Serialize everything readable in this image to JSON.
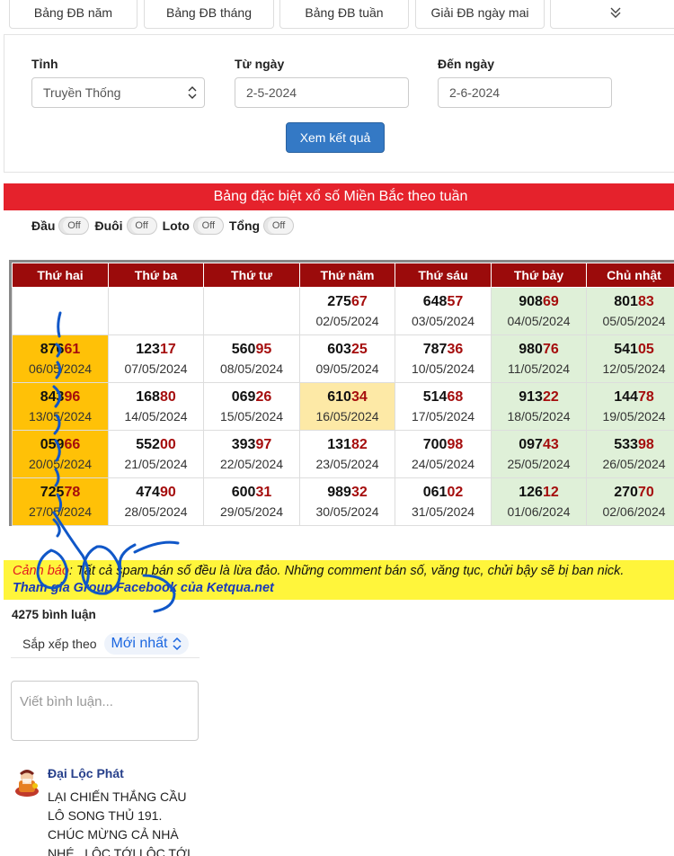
{
  "tabs": [
    {
      "label": "Bảng ĐB năm"
    },
    {
      "label": "Bảng ĐB tháng"
    },
    {
      "label": "Bảng ĐB tuần"
    },
    {
      "label": "Giải ĐB ngày mai"
    }
  ],
  "filter": {
    "province_label": "Tỉnh",
    "province_value": "Truyền Thống",
    "from_label": "Từ ngày",
    "from_value": "2-5-2024",
    "to_label": "Đến ngày",
    "to_value": "2-6-2024",
    "submit_label": "Xem kết quả"
  },
  "table_title": "Bảng đặc biệt xổ số Miền Bắc theo tuần",
  "toggles": [
    {
      "label": "Đầu",
      "state": "Off"
    },
    {
      "label": "Đuôi",
      "state": "Off"
    },
    {
      "label": "Loto",
      "state": "Off"
    },
    {
      "label": "Tổng",
      "state": "Off"
    }
  ],
  "table": {
    "headers": [
      "Thứ hai",
      "Thứ ba",
      "Thứ tư",
      "Thứ năm",
      "Thứ sáu",
      "Thứ bảy",
      "Chủ nhật"
    ],
    "rows": [
      [
        {
          "empty": true
        },
        {
          "empty": true
        },
        {
          "empty": true
        },
        {
          "pre": "275",
          "tail": "67",
          "date": "02/05/2024"
        },
        {
          "pre": "648",
          "tail": "57",
          "date": "03/05/2024"
        },
        {
          "pre": "908",
          "tail": "69",
          "date": "04/05/2024",
          "bg": "green"
        },
        {
          "pre": "801",
          "tail": "83",
          "date": "05/05/2024",
          "bg": "green"
        }
      ],
      [
        {
          "pre": "876",
          "tail": "61",
          "date": "06/05/2024",
          "bg": "yellow"
        },
        {
          "pre": "123",
          "tail": "17",
          "date": "07/05/2024"
        },
        {
          "pre": "560",
          "tail": "95",
          "date": "08/05/2024"
        },
        {
          "pre": "603",
          "tail": "25",
          "date": "09/05/2024"
        },
        {
          "pre": "787",
          "tail": "36",
          "date": "10/05/2024"
        },
        {
          "pre": "980",
          "tail": "76",
          "date": "11/05/2024",
          "bg": "green"
        },
        {
          "pre": "541",
          "tail": "05",
          "date": "12/05/2024",
          "bg": "green"
        }
      ],
      [
        {
          "pre": "843",
          "tail": "96",
          "date": "13/05/2024",
          "bg": "yellow"
        },
        {
          "pre": "168",
          "tail": "80",
          "date": "14/05/2024"
        },
        {
          "pre": "069",
          "tail": "26",
          "date": "15/05/2024"
        },
        {
          "pre": "610",
          "tail": "34",
          "date": "16/05/2024",
          "bg": "cream"
        },
        {
          "pre": "514",
          "tail": "68",
          "date": "17/05/2024"
        },
        {
          "pre": "913",
          "tail": "22",
          "date": "18/05/2024",
          "bg": "green"
        },
        {
          "pre": "144",
          "tail": "78",
          "date": "19/05/2024",
          "bg": "green"
        }
      ],
      [
        {
          "pre": "059",
          "tail": "66",
          "date": "20/05/2024",
          "bg": "yellow"
        },
        {
          "pre": "552",
          "tail": "00",
          "date": "21/05/2024"
        },
        {
          "pre": "393",
          "tail": "97",
          "date": "22/05/2024"
        },
        {
          "pre": "131",
          "tail": "82",
          "date": "23/05/2024"
        },
        {
          "pre": "700",
          "tail": "98",
          "date": "24/05/2024"
        },
        {
          "pre": "097",
          "tail": "43",
          "date": "25/05/2024",
          "bg": "green"
        },
        {
          "pre": "533",
          "tail": "98",
          "date": "26/05/2024",
          "bg": "green"
        }
      ],
      [
        {
          "pre": "725",
          "tail": "78",
          "date": "27/05/2024",
          "bg": "yellow"
        },
        {
          "pre": "474",
          "tail": "90",
          "date": "28/05/2024"
        },
        {
          "pre": "600",
          "tail": "31",
          "date": "29/05/2024"
        },
        {
          "pre": "989",
          "tail": "32",
          "date": "30/05/2024"
        },
        {
          "pre": "061",
          "tail": "02",
          "date": "31/05/2024"
        },
        {
          "pre": "126",
          "tail": "12",
          "date": "01/06/2024",
          "bg": "green"
        },
        {
          "pre": "270",
          "tail": "70",
          "date": "02/06/2024",
          "bg": "green"
        }
      ]
    ]
  },
  "warning": {
    "label": "Cảnh báo",
    "text": ": Tất cả spam bán số đều là lừa đảo. Những comment bán số, văng tục, chửi bậy sẽ bị ban nick.",
    "link": "Tham gia Group Facebook của Ketqua.net"
  },
  "comments": {
    "count": "4275 bình luận",
    "sort_label": "Sắp xếp theo",
    "sort_value": "Mới nhất",
    "input_placeholder": "Viết bình luận...",
    "items": [
      {
        "name": "Đại Lộc Phát",
        "text": "LẠI CHIẾN THẮNG CẦU LÔ SONG THỦ 191. CHÚC MỪNG CẢ NHÀ NHÉ . LỘC TỚI LỘC TỚI"
      }
    ]
  },
  "colors": {
    "header_red": "#9b0b0b",
    "title_red": "#e5222c",
    "highlight_digits": "#a50d0d",
    "monday_yellow": "#ffc107",
    "weekend_green": "#dff0d8",
    "warning_yellow": "#fff53b",
    "button_blue": "#3479c5",
    "handwriting_blue": "#1057c8"
  }
}
